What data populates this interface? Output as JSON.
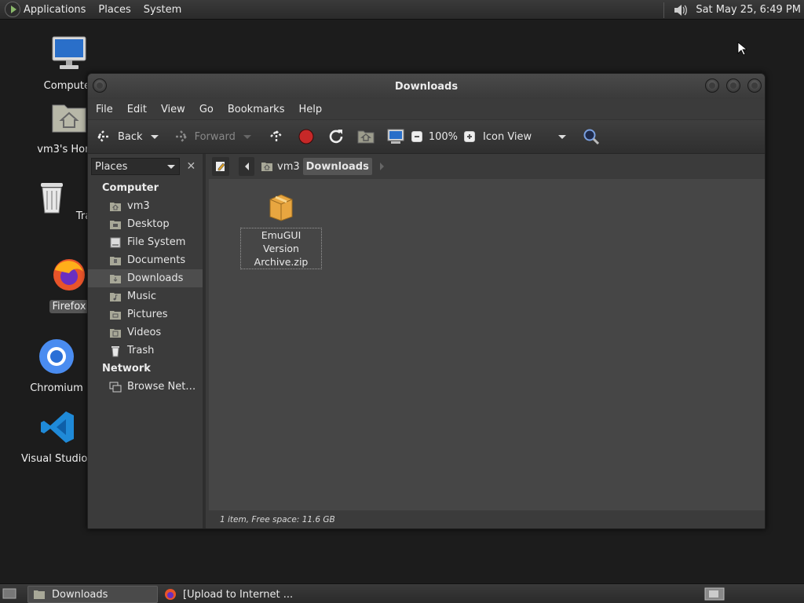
{
  "top_panel": {
    "menus": [
      "Applications",
      "Places",
      "System"
    ],
    "clock": "Sat May 25,  6:49 PM"
  },
  "desktop_icons": [
    {
      "label": "Computer",
      "icon": "computer-icon"
    },
    {
      "label": "vm3's Home",
      "icon": "home-folder-icon"
    },
    {
      "label": "Trash",
      "icon": "trash-icon"
    },
    {
      "label": "Firefox",
      "icon": "firefox-icon"
    },
    {
      "label": "Chromium",
      "icon": "chromium-icon"
    },
    {
      "label": "Visual Studio Code",
      "icon": "vscode-icon"
    }
  ],
  "window": {
    "title": "Downloads",
    "menu": [
      "File",
      "Edit",
      "View",
      "Go",
      "Bookmarks",
      "Help"
    ],
    "toolbar": {
      "back": "Back",
      "forward": "Forward",
      "zoom": "100%",
      "view_mode": "Icon View"
    },
    "sidebar": {
      "header": "Places",
      "sections": [
        {
          "title": "Computer",
          "items": [
            "vm3",
            "Desktop",
            "File System",
            "Documents",
            "Downloads",
            "Music",
            "Pictures",
            "Videos",
            "Trash"
          ]
        },
        {
          "title": "Network",
          "items": [
            "Browse Net…"
          ]
        }
      ],
      "active": "Downloads"
    },
    "path": [
      "vm3",
      "Downloads"
    ],
    "files": [
      {
        "name_line1": "EmuGUI Version",
        "name_line2": "Archive.zip",
        "icon": "archive-icon"
      }
    ],
    "status": "1 item, Free space: 11.6 GB"
  },
  "taskbar": {
    "items": [
      {
        "label": "Downloads",
        "active": true,
        "icon": "folder-icon"
      },
      {
        "label": "[Upload to Internet ...",
        "active": false,
        "icon": "firefox-icon"
      }
    ]
  }
}
